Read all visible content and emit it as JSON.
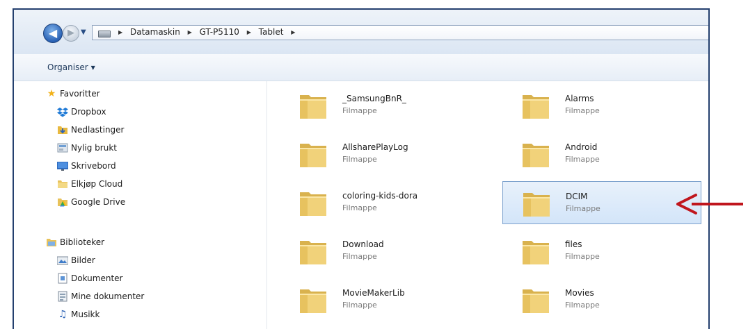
{
  "breadcrumb": {
    "items": [
      "Datamaskin",
      "GT-P5110",
      "Tablet"
    ]
  },
  "toolbar": {
    "organise_label": "Organiser"
  },
  "sidebar": {
    "favorites": {
      "header": "Favoritter",
      "items": [
        {
          "label": "Dropbox",
          "icon": "dropbox-icon"
        },
        {
          "label": "Nedlastinger",
          "icon": "downloads-icon"
        },
        {
          "label": "Nylig brukt",
          "icon": "recent-places-icon"
        },
        {
          "label": "Skrivebord",
          "icon": "desktop-icon"
        },
        {
          "label": "Elkjøp Cloud",
          "icon": "folder-icon"
        },
        {
          "label": "Google Drive",
          "icon": "google-drive-icon"
        }
      ]
    },
    "libraries": {
      "header": "Biblioteker",
      "items": [
        {
          "label": "Bilder",
          "icon": "pictures-icon"
        },
        {
          "label": "Dokumenter",
          "icon": "documents-icon"
        },
        {
          "label": "Mine dokumenter",
          "icon": "my-documents-icon"
        },
        {
          "label": "Musikk",
          "icon": "music-icon"
        }
      ]
    }
  },
  "folders": [
    {
      "name": "_SamsungBnR_",
      "type": "Filmappe"
    },
    {
      "name": "Alarms",
      "type": "Filmappe"
    },
    {
      "name": "AllsharePlayLog",
      "type": "Filmappe"
    },
    {
      "name": "Android",
      "type": "Filmappe"
    },
    {
      "name": "coloring-kids-dora",
      "type": "Filmappe"
    },
    {
      "name": "DCIM",
      "type": "Filmappe",
      "selected": true
    },
    {
      "name": "Download",
      "type": "Filmappe"
    },
    {
      "name": "files",
      "type": "Filmappe"
    },
    {
      "name": "MovieMakerLib",
      "type": "Filmappe"
    },
    {
      "name": "Movies",
      "type": "Filmappe"
    }
  ],
  "colors": {
    "frame_border": "#24406e",
    "selection_fill": "#d3e5f9",
    "selection_border": "#7da2ce",
    "annotation_arrow": "#c0161d",
    "folder_yellow": "#f1d27a"
  }
}
